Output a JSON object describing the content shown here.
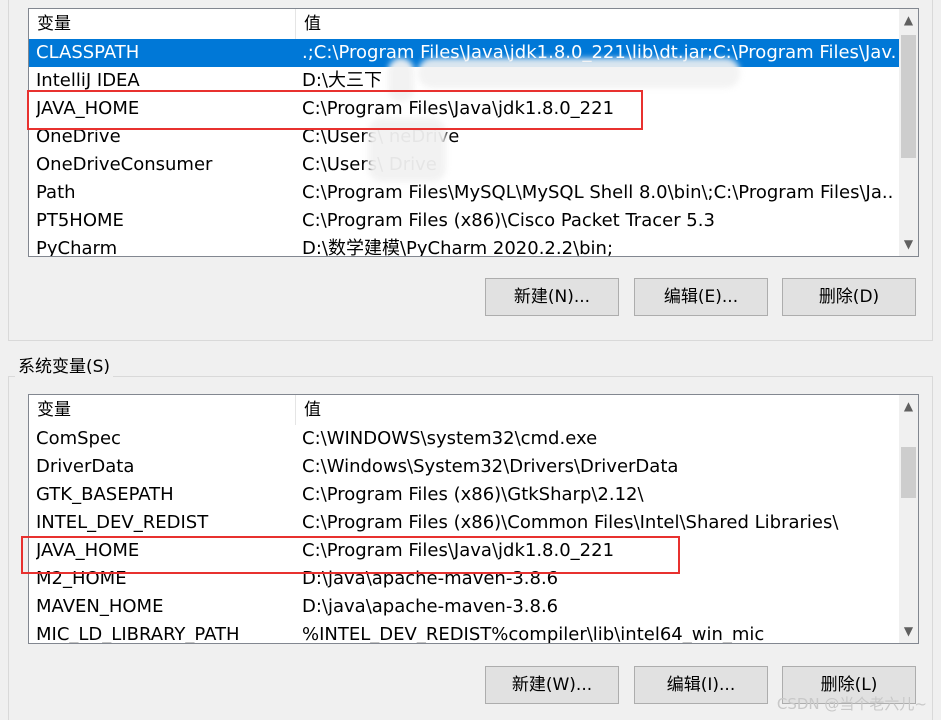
{
  "user_vars": {
    "headers": {
      "name": "变量",
      "value": "值"
    },
    "rows": [
      {
        "name": "CLASSPATH",
        "value": ".;C:\\Program Files\\Java\\jdk1.8.0_221\\lib\\dt.jar;C:\\Program Files\\Jav..."
      },
      {
        "name": "IntelliJ IDEA",
        "value": "D:\\大三下"
      },
      {
        "name": "JAVA_HOME",
        "value": "C:\\Program Files\\Java\\jdk1.8.0_221"
      },
      {
        "name": "OneDrive",
        "value": "C:\\Users\\ neDrive"
      },
      {
        "name": "OneDriveConsumer",
        "value": "C:\\Users\\ Drive"
      },
      {
        "name": "Path",
        "value": "C:\\Program Files\\MySQL\\MySQL Shell 8.0\\bin\\;C:\\Program Files\\Ja..."
      },
      {
        "name": "PT5HOME",
        "value": "C:\\Program Files (x86)\\Cisco Packet Tracer 5.3"
      },
      {
        "name": "PyCharm",
        "value": "D:\\数学建模\\PyCharm 2020.2.2\\bin;"
      }
    ],
    "selected_index": 0,
    "buttons": {
      "new": "新建(N)...",
      "edit": "编辑(E)...",
      "delete": "删除(D)"
    }
  },
  "system_vars": {
    "group_label": "系统变量(S)",
    "headers": {
      "name": "变量",
      "value": "值"
    },
    "rows": [
      {
        "name": "ComSpec",
        "value": "C:\\WINDOWS\\system32\\cmd.exe"
      },
      {
        "name": "DriverData",
        "value": "C:\\Windows\\System32\\Drivers\\DriverData"
      },
      {
        "name": "GTK_BASEPATH",
        "value": "C:\\Program Files (x86)\\GtkSharp\\2.12\\"
      },
      {
        "name": "INTEL_DEV_REDIST",
        "value": "C:\\Program Files (x86)\\Common Files\\Intel\\Shared Libraries\\"
      },
      {
        "name": "JAVA_HOME",
        "value": "C:\\Program Files\\Java\\jdk1.8.0_221"
      },
      {
        "name": "M2_HOME",
        "value": "D:\\java\\apache-maven-3.8.6"
      },
      {
        "name": "MAVEN_HOME",
        "value": "D:\\java\\apache-maven-3.8.6"
      },
      {
        "name": "MIC_LD_LIBRARY_PATH",
        "value": "%INTEL_DEV_REDIST%compiler\\lib\\intel64_win_mic"
      }
    ],
    "buttons": {
      "new": "新建(W)...",
      "edit": "编辑(I)...",
      "delete": "删除(L)"
    }
  },
  "watermark": "CSDN @当个老六儿~",
  "colors": {
    "selection": "#0078d7",
    "highlight_box": "#e8312f",
    "button_face": "#e1e1e1"
  },
  "icons": {
    "scroll_up": "chevron-up-icon",
    "scroll_down": "chevron-down-icon"
  }
}
